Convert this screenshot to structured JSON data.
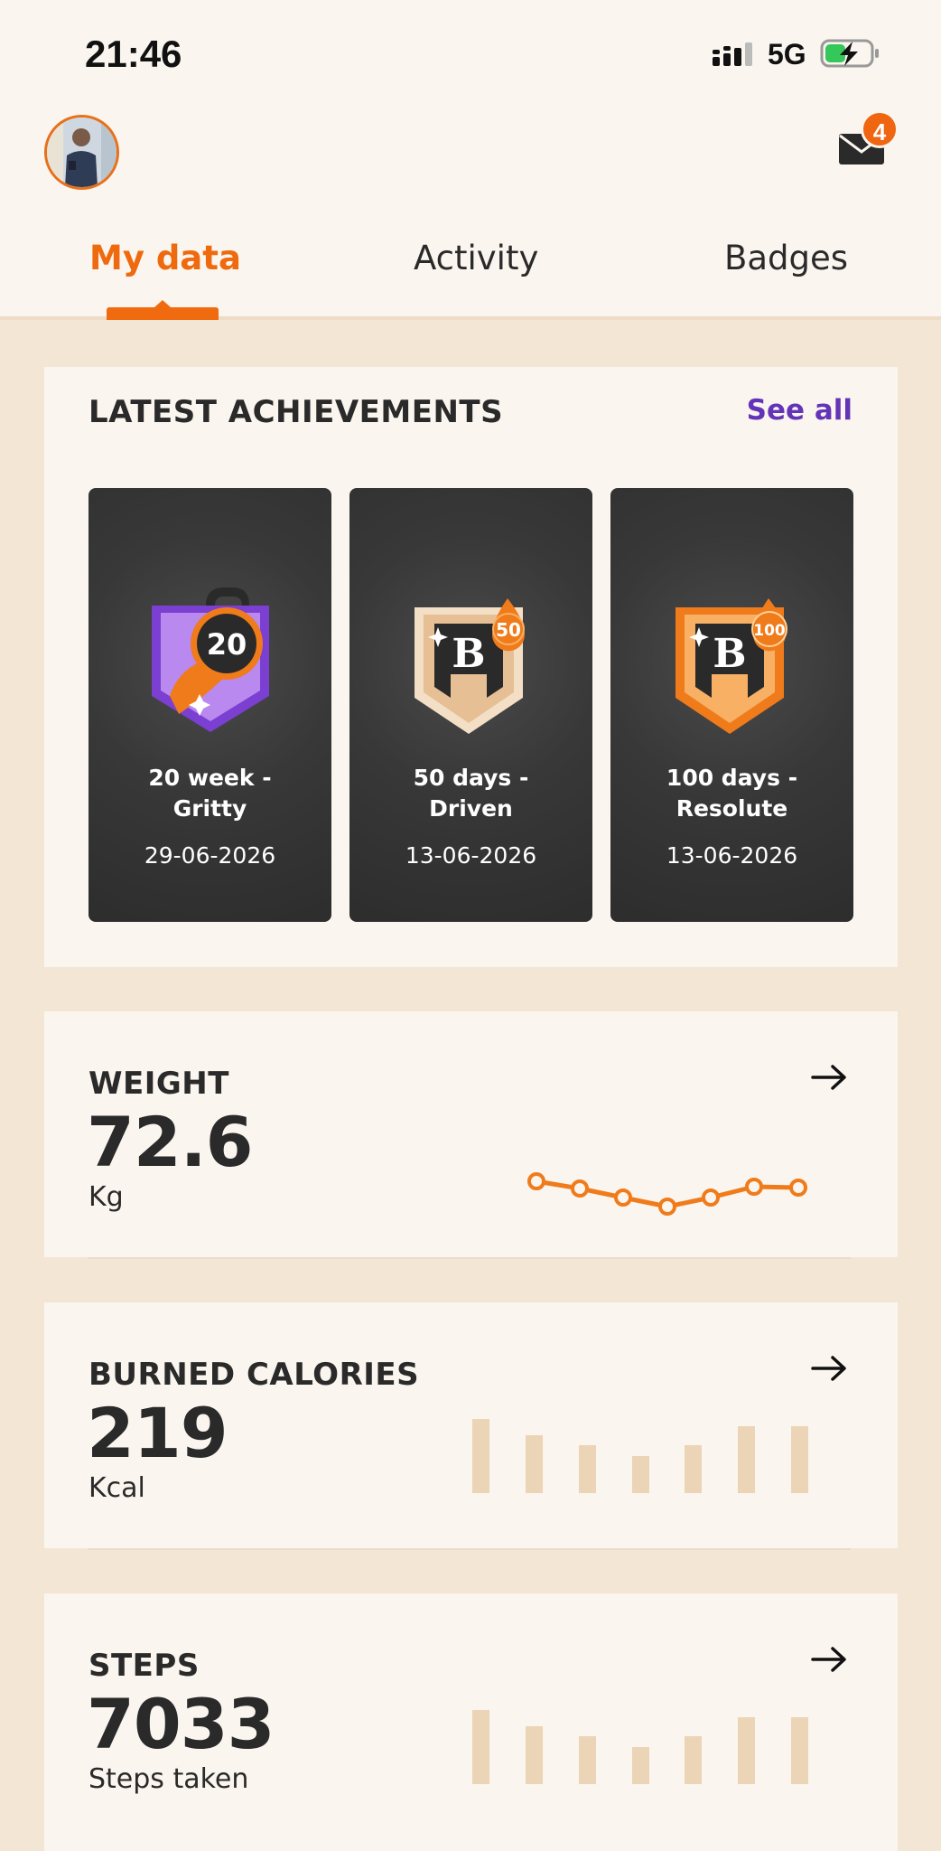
{
  "status_bar": {
    "time": "21:46",
    "network": "5G"
  },
  "header": {
    "mail_count": "4"
  },
  "tabs": [
    {
      "label": "My data",
      "active": true
    },
    {
      "label": "Activity",
      "active": false
    },
    {
      "label": "Badges",
      "active": false
    }
  ],
  "achievements": {
    "title": "LATEST ACHIEVEMENTS",
    "see_all": "See all",
    "items": [
      {
        "name": "20 week -\nGritty",
        "date": "29-06-2026",
        "badge_text": "20",
        "badge_icon": "kettlebell-badge-icon"
      },
      {
        "name": "50 days -\nDriven",
        "date": "13-06-2026",
        "badge_text": "50",
        "badge_icon": "b-shield-badge-icon"
      },
      {
        "name": "100 days -\nResolute",
        "date": "13-06-2026",
        "badge_text": "100",
        "badge_icon": "b-shield-orange-badge-icon"
      }
    ]
  },
  "metrics": {
    "weight": {
      "title": "WEIGHT",
      "value": "72.6",
      "unit": "Kg"
    },
    "calories": {
      "title": "BURNED CALORIES",
      "value": "219",
      "unit": "Kcal"
    },
    "steps": {
      "title": "STEPS",
      "value": "7033",
      "unit": "Steps taken"
    }
  },
  "colors": {
    "accent": "#ef6a0e",
    "link": "#6434b8",
    "bar": "#ecd4b6",
    "background": "#f3e6d5",
    "card": "#faf5ef"
  }
}
